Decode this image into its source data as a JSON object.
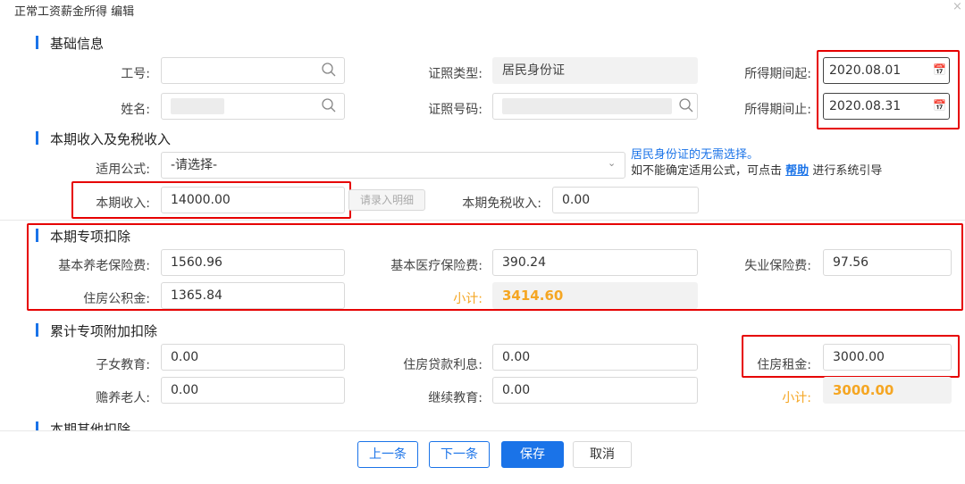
{
  "dialog": {
    "title": "正常工资薪金所得 编辑",
    "close_label": "×"
  },
  "sections": {
    "basic": "基础信息",
    "income": "本期收入及免税收入",
    "special": "本期专项扣除",
    "cumulative": "累计专项附加扣除",
    "other": "本期其他扣除"
  },
  "basic": {
    "emp_no_label": "工号:",
    "emp_no_value": "",
    "name_label": "姓名:",
    "id_type_label": "证照类型:",
    "id_type_value": "居民身份证",
    "id_no_label": "证照号码:",
    "period_start_label": "所得期间起:",
    "period_start_value": "2020.08.01",
    "period_end_label": "所得期间止:",
    "period_end_value": "2020.08.31"
  },
  "income": {
    "formula_label": "适用公式:",
    "formula_value": "-请选择-",
    "note_line1": "居民身份证的无需选择。",
    "note_line2_prefix": "如不能确定适用公式，可点击",
    "note_help_link": "帮助",
    "note_line2_suffix": "进行系统引导",
    "current_income_label": "本期收入:",
    "current_income_value": "14000.00",
    "detail_button": "请录入明细",
    "tax_free_label": "本期免税收入:",
    "tax_free_value": "0.00"
  },
  "special": {
    "pension_label": "基本养老保险费:",
    "pension_value": "1560.96",
    "medical_label": "基本医疗保险费:",
    "medical_value": "390.24",
    "unemployment_label": "失业保险费:",
    "unemployment_value": "97.56",
    "housing_fund_label": "住房公积金:",
    "housing_fund_value": "1365.84",
    "subtotal_label": "小计:",
    "subtotal_value": "3414.60"
  },
  "cumulative": {
    "children_edu_label": "子女教育:",
    "children_edu_value": "0.00",
    "loan_interest_label": "住房贷款利息:",
    "loan_interest_value": "0.00",
    "rent_label": "住房租金:",
    "rent_value": "3000.00",
    "elderly_label": "赡养老人:",
    "elderly_value": "0.00",
    "continuing_edu_label": "继续教育:",
    "continuing_edu_value": "0.00",
    "subtotal_label": "小计:",
    "subtotal_value": "3000.00"
  },
  "footer": {
    "prev": "上一条",
    "next": "下一条",
    "save": "保存",
    "cancel": "取消"
  },
  "colors": {
    "accent": "#1a73e8",
    "highlight": "#e60000",
    "subtotal": "#f5a623"
  }
}
